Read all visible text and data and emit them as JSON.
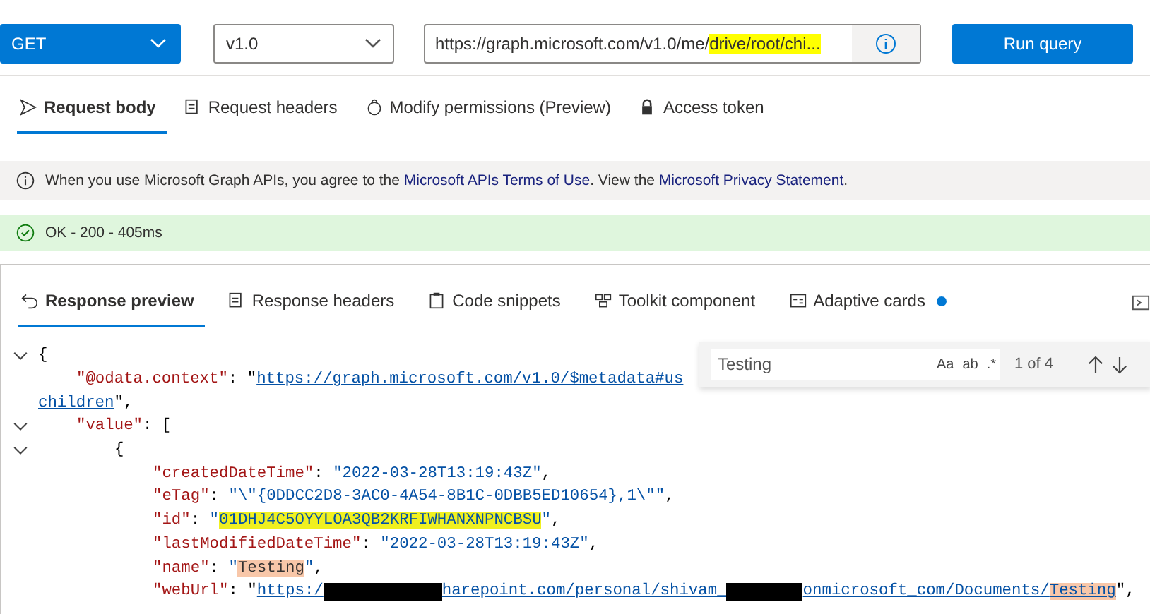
{
  "query": {
    "method": "GET",
    "version": "v1.0",
    "url_prefix": "https://graph.microsoft.com/v1.0/me/",
    "url_highlight": "drive/root/chi...",
    "run": "Run query"
  },
  "request_tabs": [
    {
      "label": "Request body",
      "selected": true
    },
    {
      "label": "Request headers",
      "selected": false
    },
    {
      "label": "Modify permissions (Preview)",
      "selected": false
    },
    {
      "label": "Access token",
      "selected": false
    }
  ],
  "notice": {
    "parts": [
      {
        "kind": "text",
        "text": "When you use Microsoft Graph APIs, you agree to the "
      },
      {
        "kind": "link",
        "text": "Microsoft APIs Terms of Use"
      },
      {
        "kind": "text",
        "text": ". View the "
      },
      {
        "kind": "link",
        "text": "Microsoft Privacy Statement"
      },
      {
        "kind": "text",
        "text": "."
      }
    ]
  },
  "status": {
    "text": "OK - 200 - 405ms"
  },
  "response_tabs": [
    {
      "label": "Response preview",
      "selected": true,
      "dot": false
    },
    {
      "label": "Response headers",
      "selected": false,
      "dot": false
    },
    {
      "label": "Code snippets",
      "selected": false,
      "dot": false
    },
    {
      "label": "Toolkit component",
      "selected": false,
      "dot": false
    },
    {
      "label": "Adaptive cards",
      "selected": false,
      "dot": true
    }
  ],
  "find": {
    "value": "Testing",
    "count": "1 of 4",
    "options": [
      "Aa",
      "ab",
      ".*"
    ]
  },
  "code": [
    {
      "fold": true,
      "segs": [
        {
          "kind": "punct",
          "text": "{"
        }
      ],
      "children": [
        {
          "fold": false,
          "segs": [
            {
              "kind": "key",
              "text": "\"@odata.context\""
            },
            {
              "kind": "punct",
              "text": ": \""
            },
            {
              "kind": "link",
              "text": "https://graph.microsoft.com/v1.0/$metadata#us"
            }
          ],
          "wrap": [
            {
              "kind": "link",
              "text": "children"
            },
            {
              "kind": "punct",
              "text": "\","
            }
          ]
        },
        {
          "fold": true,
          "segs": [
            {
              "kind": "key",
              "text": "\"value\""
            },
            {
              "kind": "punct",
              "text": ": ["
            }
          ],
          "children": [
            {
              "fold": true,
              "segs": [
                {
                  "kind": "punct",
                  "text": "{"
                }
              ],
              "children": [
                {
                  "fold": false,
                  "segs": [
                    {
                      "kind": "key",
                      "text": "\"createdDateTime\""
                    },
                    {
                      "kind": "punct",
                      "text": ": "
                    },
                    {
                      "kind": "string",
                      "text": "\"2022-03-28T13:19:43Z\""
                    },
                    {
                      "kind": "punct",
                      "text": ","
                    }
                  ]
                },
                {
                  "fold": false,
                  "segs": [
                    {
                      "kind": "key",
                      "text": "\"eTag\""
                    },
                    {
                      "kind": "punct",
                      "text": ": "
                    },
                    {
                      "kind": "string",
                      "text": "\"\\\"{0DDCC2D8-3AC0-4A54-8B1C-0DBB5ED10654},1\\\"\""
                    },
                    {
                      "kind": "punct",
                      "text": ","
                    }
                  ]
                },
                {
                  "fold": false,
                  "segs": [
                    {
                      "kind": "key",
                      "text": "\"id\""
                    },
                    {
                      "kind": "punct",
                      "text": ": "
                    },
                    {
                      "kind": "string",
                      "text": "\""
                    },
                    {
                      "kind": "mark",
                      "text": "01DHJ4C5OYYLOA3QB2KRFIWHANXNPNCBSU"
                    },
                    {
                      "kind": "string",
                      "text": "\""
                    },
                    {
                      "kind": "punct",
                      "text": ","
                    }
                  ]
                },
                {
                  "fold": false,
                  "segs": [
                    {
                      "kind": "key",
                      "text": "\"lastModifiedDateTime\""
                    },
                    {
                      "kind": "punct",
                      "text": ": "
                    },
                    {
                      "kind": "string",
                      "text": "\"2022-03-28T13:19:43Z\""
                    },
                    {
                      "kind": "punct",
                      "text": ","
                    }
                  ]
                },
                {
                  "fold": false,
                  "segs": [
                    {
                      "kind": "key",
                      "text": "\"name\""
                    },
                    {
                      "kind": "punct",
                      "text": ": "
                    },
                    {
                      "kind": "string",
                      "text": "\""
                    },
                    {
                      "kind": "match",
                      "text": "Testing"
                    },
                    {
                      "kind": "string",
                      "text": "\""
                    },
                    {
                      "kind": "punct",
                      "text": ","
                    }
                  ]
                },
                {
                  "fold": false,
                  "segs": [
                    {
                      "kind": "key",
                      "text": "\"webUrl\""
                    },
                    {
                      "kind": "punct",
                      "text": ": \""
                    },
                    {
                      "kind": "link",
                      "text": "https:/"
                    },
                    {
                      "kind": "redacted"
                    },
                    {
                      "kind": "link",
                      "text": "harepoint.com/personal/shivam_"
                    },
                    {
                      "kind": "redacted"
                    },
                    {
                      "kind": "link",
                      "text": "onmicrosoft_com/Documents/"
                    },
                    {
                      "kind": "linkmatch",
                      "text": "Testing"
                    },
                    {
                      "kind": "punct",
                      "text": "\","
                    }
                  ]
                }
              ]
            }
          ]
        }
      ]
    }
  ]
}
